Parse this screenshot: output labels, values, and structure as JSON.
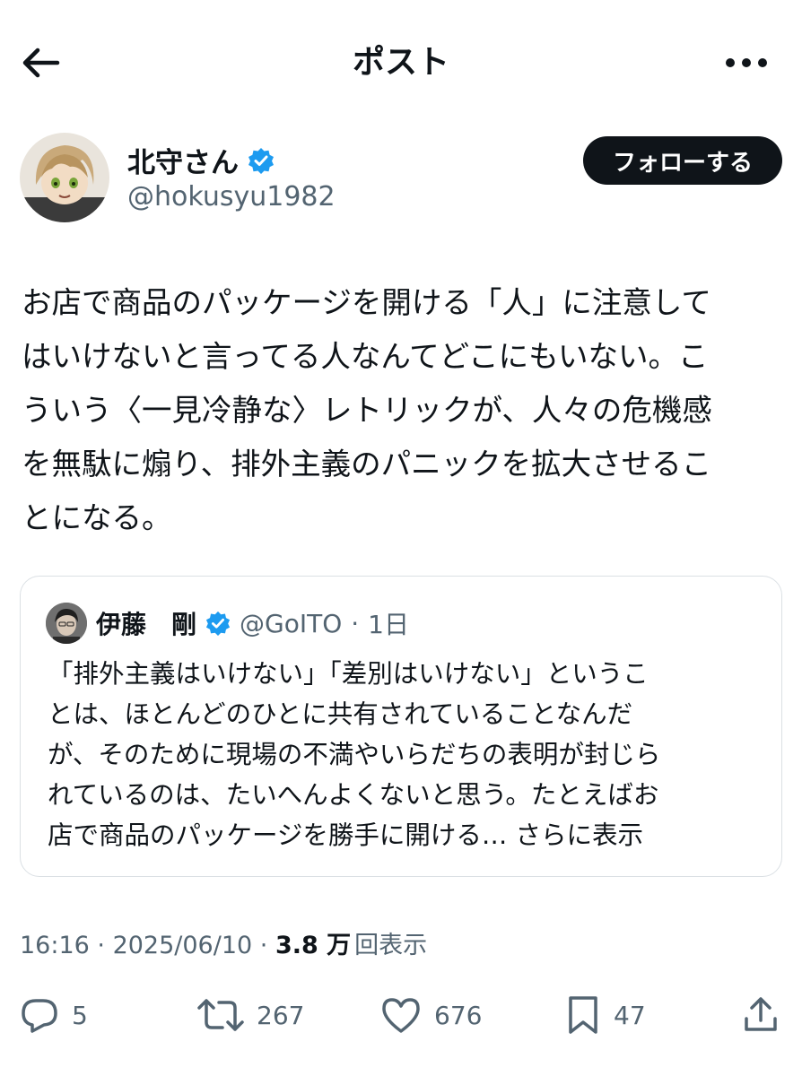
{
  "header": {
    "title": "ポスト"
  },
  "author": {
    "name": "北守さん",
    "handle": "@hokusyu1982",
    "verified": true,
    "follow_label": "フォローする"
  },
  "post": {
    "text": "お店で商品のパッケージを開ける「人」に注意して\nはいけないと言ってる人なんてどこにもいない。こ\nういう〈一見冷静な〉レトリックが、人々の危機感\nを無駄に煽り、排外主義のパニックを拡大させるこ\nとになる。"
  },
  "quote": {
    "name": "伊藤　剛",
    "handle": "@GoITO",
    "separator": "·",
    "time": "1日",
    "text": "「排外主義はいけない」「差別はいけない」というこ\nとは、ほとんどのひとに共有されていることなんだ\nが、そのために現場の不満やいらだちの表明が封じら\nれているのは、たいへんよくないと思う。たとえばお\n店で商品のパッケージを勝手に開ける… ",
    "show_more": "さらに表示"
  },
  "meta": {
    "time": "16:16",
    "sep1": " · ",
    "date": "2025/06/10",
    "sep2": " · ",
    "views_count": "3.8 万",
    "views_label": "回表示"
  },
  "actions": {
    "replies": "5",
    "reposts": "267",
    "likes": "676",
    "bookmarks": "47"
  },
  "colors": {
    "text": "#0f1419",
    "secondary": "#536471",
    "verified": "#1d9bf0",
    "border": "#dbe0e4"
  }
}
